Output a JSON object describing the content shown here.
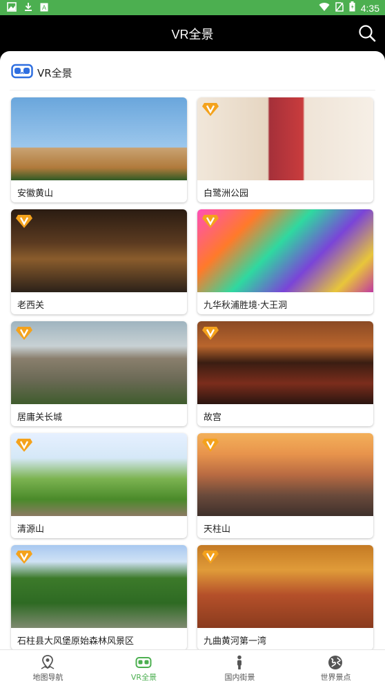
{
  "status_bar": {
    "time": "4:35",
    "left_icons": [
      "photo-icon",
      "download-icon",
      "text-icon"
    ],
    "right_icons": [
      "wifi-icon",
      "no-sim-icon",
      "battery-icon"
    ]
  },
  "app_bar": {
    "title": "VR全景",
    "search_icon": "search-icon"
  },
  "section": {
    "icon": "vr-headset-icon",
    "title": "VR全景"
  },
  "cards": [
    {
      "label": "安徽黄山",
      "vip": false
    },
    {
      "label": "白鹭洲公园",
      "vip": true
    },
    {
      "label": "老西关",
      "vip": true
    },
    {
      "label": "九华秋浦胜境·大王洞",
      "vip": true
    },
    {
      "label": "居庸关长城",
      "vip": true
    },
    {
      "label": "故宫",
      "vip": true
    },
    {
      "label": "清源山",
      "vip": true
    },
    {
      "label": "天柱山",
      "vip": true
    },
    {
      "label": "石柱县大风堡原始森林风景区",
      "vip": true
    },
    {
      "label": "九曲黄河第一湾",
      "vip": true
    }
  ],
  "bottom_nav": {
    "items": [
      {
        "label": "地图导航",
        "icon": "map-pin-icon",
        "active": false
      },
      {
        "label": "VR全景",
        "icon": "vr-headset-icon",
        "active": true
      },
      {
        "label": "国内街景",
        "icon": "person-icon",
        "active": false
      },
      {
        "label": "世界景点",
        "icon": "globe-icon",
        "active": false
      }
    ]
  },
  "colors": {
    "status_bar": "#4caf50",
    "app_bar": "#000000",
    "accent": "#4caf50",
    "vip_badge": "#f4a21c",
    "vr_icon": "#2f6fe0"
  }
}
